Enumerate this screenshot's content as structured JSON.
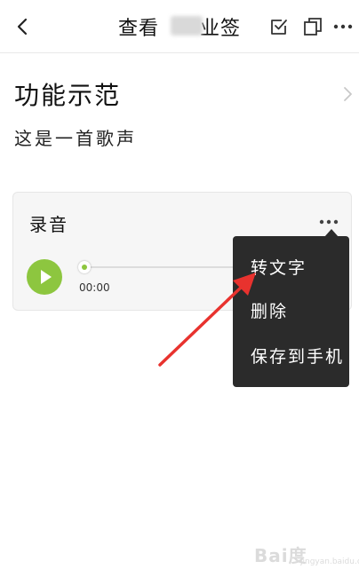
{
  "header": {
    "title": "查看　　业签",
    "back_icon": "chevron-left-icon",
    "check_icon": "checkbox-icon",
    "copy_icon": "copy-icon",
    "more_icon": "more-dots-icon"
  },
  "note": {
    "title": "功能示范",
    "body": "这是一首歌声"
  },
  "recording": {
    "label": "录音",
    "time": "00:00",
    "progress": 0,
    "play_color": "#8dc63f"
  },
  "menu": {
    "items": [
      "转文字",
      "删除",
      "保存到手机"
    ],
    "background": "#2b2b2b"
  },
  "annotation": {
    "arrow_color": "#e8322e"
  },
  "watermark": {
    "brand": "Bai度",
    "sub": "jingyan.baidu.com"
  }
}
